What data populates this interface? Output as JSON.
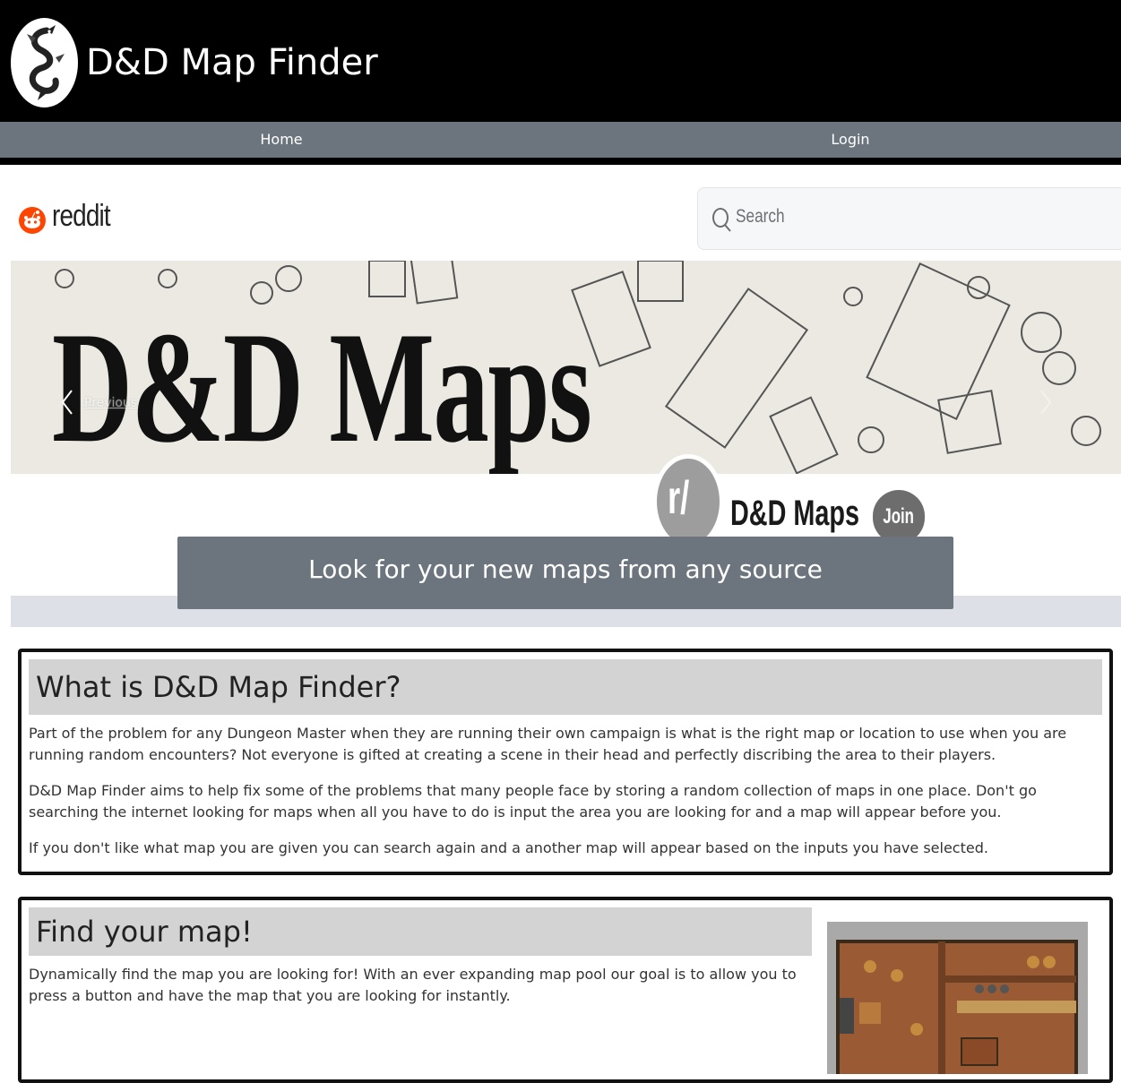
{
  "header": {
    "title": "D&D Map Finder",
    "logo_icon": "dragon-logo-icon"
  },
  "nav": {
    "home": "Home",
    "login": "Login"
  },
  "carousel": {
    "reddit_word": "reddit",
    "search_placeholder": "Search",
    "banner_title": "D&D Maps",
    "prev_label": "Previous",
    "subreddit_prefix": "r/",
    "subreddit_name": "D&D Maps",
    "join_label": "Join",
    "tagline": "Look for your new maps from any source"
  },
  "about": {
    "heading": "What is D&D Map Finder?",
    "paragraphs": [
      "Part of the problem for any Dungeon Master when they are running their own campaign is what is the right map or location to use when you are running random encounters? Not everyone is gifted at creating a scene in their head and perfectly discribing the area to their players.",
      "D&D Map Finder aims to help fix some of the problems that many people face by storing a random collection of maps in one place. Don't go searching the internet looking for maps when all you have to do is input the area you are looking for and a map will appear before you.",
      "If you don't like what map you are given you can search again and a another map will appear based on the inputs you have selected."
    ]
  },
  "find": {
    "heading": "Find your map!",
    "paragraph": "Dynamically find the map you are looking for! With an ever expanding map pool our goal is to allow you to press a button and have the map that you are looking for instantly."
  },
  "colors": {
    "header_bg": "#000000",
    "nav_bg": "#6c757d",
    "heading_bg": "#d3d3d3",
    "reddit_orange": "#ff4500"
  }
}
